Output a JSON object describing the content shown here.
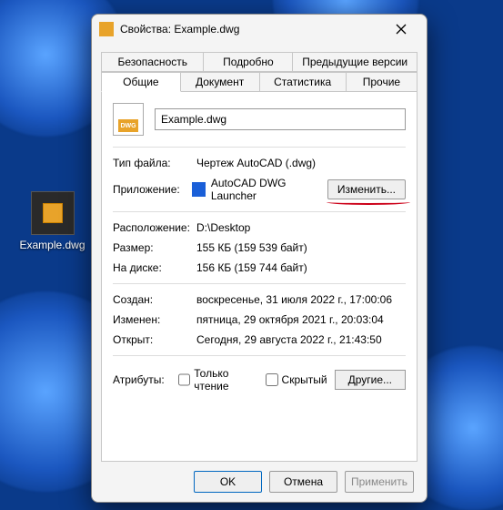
{
  "window": {
    "title": "Свойства: Example.dwg"
  },
  "tabs": {
    "row1": [
      "Безопасность",
      "Подробно",
      "Предыдущие версии"
    ],
    "row2": [
      "Общие",
      "Документ",
      "Статистика",
      "Прочие"
    ],
    "active": "Общие"
  },
  "header": {
    "filename": "Example.dwg",
    "dwg_badge": "DWG"
  },
  "filetype": {
    "label": "Тип файла:",
    "value": "Чертеж AutoCAD (.dwg)"
  },
  "app": {
    "label": "Приложение:",
    "value": "AutoCAD DWG Launcher",
    "change_btn": "Изменить..."
  },
  "location": {
    "label": "Расположение:",
    "value": "D:\\Desktop"
  },
  "size": {
    "label": "Размер:",
    "value": "155 КБ (159 539 байт)"
  },
  "ondisk": {
    "label": "На диске:",
    "value": "156 КБ (159 744 байт)"
  },
  "created": {
    "label": "Создан:",
    "value": "воскресенье, 31 июля 2022 г., 17:00:06"
  },
  "modified": {
    "label": "Изменен:",
    "value": "пятница, 29 октября 2021 г., 20:03:04"
  },
  "accessed": {
    "label": "Открыт:",
    "value": "Сегодня, 29 августа 2022 г., 21:43:50"
  },
  "attributes": {
    "label": "Атрибуты:",
    "readonly": "Только чтение",
    "hidden": "Скрытый",
    "other_btn": "Другие..."
  },
  "dialog": {
    "ok": "OK",
    "cancel": "Отмена",
    "apply": "Применить"
  },
  "desktop": {
    "filename": "Example.dwg"
  }
}
